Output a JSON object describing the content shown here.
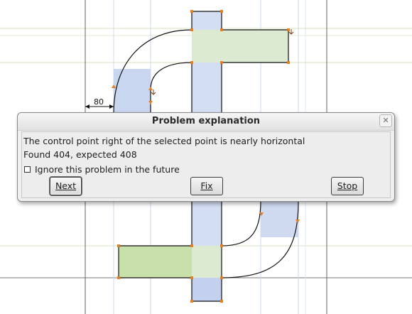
{
  "canvas": {
    "dimension_label": "80"
  },
  "dialog": {
    "title": "Problem explanation",
    "close_glyph": "✕",
    "message": "The control point right of the selected point is nearly horizontal",
    "detail": "Found 404, expected 408",
    "ignore_label": "Ignore this problem in the future",
    "ignore_checked": false,
    "buttons": {
      "next": "Next",
      "fix": "Fix",
      "stop": "Stop"
    }
  },
  "colors": {
    "point_orange": "#e67e22",
    "glyph_blue": "#aebfe6",
    "glyph_green": "#c6e0ad",
    "guide_green": "#c9dcae",
    "guide_blue": "#c6d4ee"
  }
}
